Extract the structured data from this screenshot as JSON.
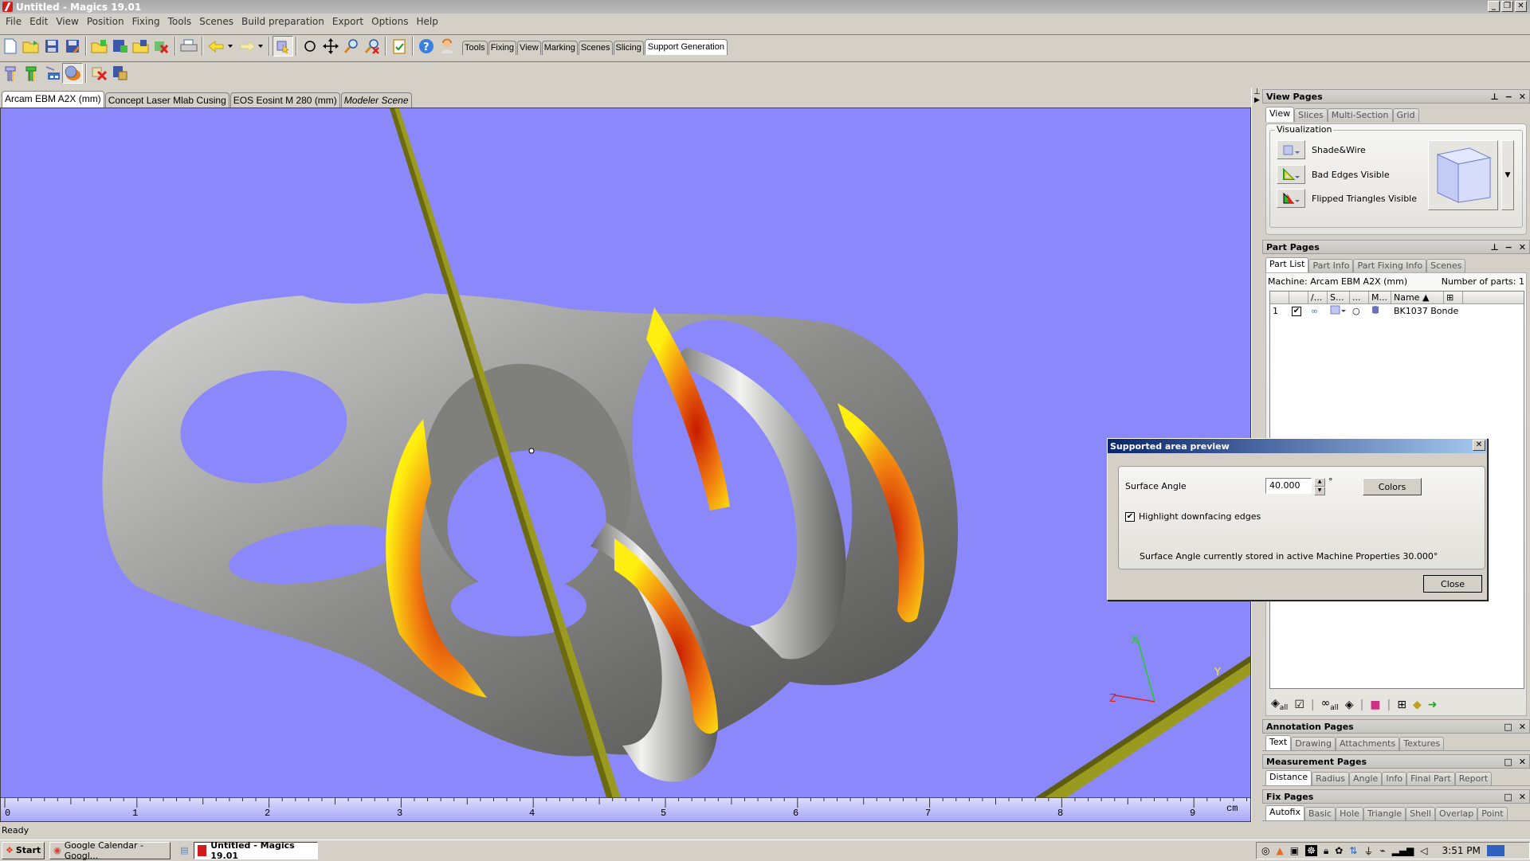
{
  "window": {
    "title": "Untitled - Magics 19.01",
    "buttons": [
      "_",
      "❐",
      "✕"
    ]
  },
  "menu": [
    "File",
    "Edit",
    "View",
    "Position",
    "Fixing",
    "Tools",
    "Scenes",
    "Build preparation",
    "Export",
    "Options",
    "Help"
  ],
  "toolbar": {
    "context_tabs": [
      "Tools",
      "Fixing",
      "View",
      "Marking",
      "Scenes",
      "Slicing",
      "Support Generation"
    ],
    "active_context_tab": "Support Generation"
  },
  "scene_tabs": [
    {
      "label": "Arcam EBM A2X (mm)",
      "active": true
    },
    {
      "label": "Concept Laser Mlab Cusing",
      "active": false
    },
    {
      "label": "EOS Eosint M 280 (mm)",
      "active": false
    },
    {
      "label": "Modeler Scene",
      "active": false
    }
  ],
  "viewport": {
    "background": "#8b88fc",
    "ruler_labels": [
      "0",
      "1",
      "2",
      "3",
      "4",
      "5",
      "6",
      "7",
      "8",
      "9"
    ],
    "ruler_unit": "cm",
    "axes": {
      "x": "X",
      "y": "Y",
      "z": "Z"
    }
  },
  "view_pages": {
    "title": "View Pages",
    "tabs": [
      "View",
      "Slices",
      "Multi-Section",
      "Grid"
    ],
    "group_label": "Visualization",
    "items": [
      {
        "label": "Shade&Wire",
        "icon": "shade-wire-icon"
      },
      {
        "label": "Bad Edges Visible",
        "icon": "bad-edges-icon"
      },
      {
        "label": "Flipped Triangles Visible",
        "icon": "flipped-triangles-icon"
      }
    ]
  },
  "part_pages": {
    "title": "Part Pages",
    "tabs": [
      "Part List",
      "Part Info",
      "Part Fixing Info",
      "Scenes"
    ],
    "machine": "Machine: Arcam EBM A2X (mm)",
    "num_parts": "Number of parts: 1",
    "columns": [
      "",
      "",
      "/...",
      "S...",
      "...",
      "M...",
      "Name ▲",
      "⊞"
    ],
    "rows": [
      {
        "index": "1",
        "checked": true,
        "name": "BK1037 Bonde"
      }
    ]
  },
  "annotation_pages": {
    "title": "Annotation Pages",
    "tabs": [
      "Text",
      "Drawing",
      "Attachments",
      "Textures"
    ]
  },
  "measurement_pages": {
    "title": "Measurement Pages",
    "tabs": [
      "Distance",
      "Radius",
      "Angle",
      "Info",
      "Final Part",
      "Report"
    ]
  },
  "fix_pages": {
    "title": "Fix Pages",
    "tabs": [
      "Autofix",
      "Basic",
      "Hole",
      "Triangle",
      "Shell",
      "Overlap",
      "Point"
    ]
  },
  "dialog": {
    "title": "Supported area preview",
    "surface_angle_label": "Surface Angle",
    "surface_angle_value": "40.000",
    "degree_symbol": "°",
    "colors_button": "Colors",
    "highlight_label": "Highlight downfacing edges",
    "highlight_checked": true,
    "info_text": "Surface Angle currently stored in active Machine Properties 30.000°",
    "close_button": "Close"
  },
  "status": {
    "text": "Ready"
  },
  "taskbar": {
    "start": "Start",
    "items": [
      {
        "label": "Google Calendar - Googl...",
        "active": false
      },
      {
        "label": "Untitled - Magics 19.01",
        "active": true
      }
    ],
    "clock": "3:51 PM"
  }
}
